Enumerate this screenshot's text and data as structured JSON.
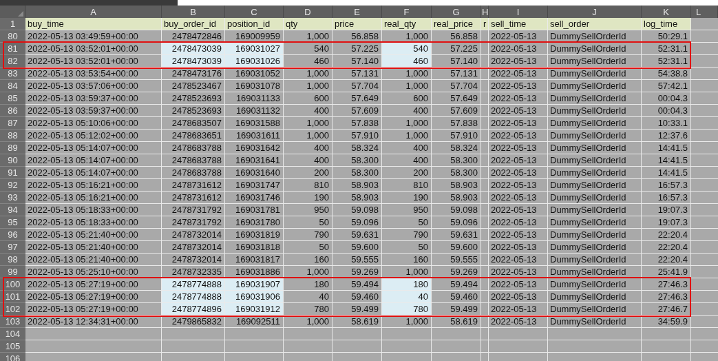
{
  "columns": [
    {
      "letter": "A",
      "header": "buy_time",
      "kind": "text",
      "highlighted": false
    },
    {
      "letter": "B",
      "header": "buy_order_id",
      "kind": "number",
      "highlighted": true
    },
    {
      "letter": "C",
      "header": "position_id",
      "kind": "number",
      "highlighted": true
    },
    {
      "letter": "D",
      "header": "qty",
      "kind": "number",
      "highlighted": false
    },
    {
      "letter": "E",
      "header": "price",
      "kind": "number",
      "highlighted": false
    },
    {
      "letter": "F",
      "header": "real_qty",
      "kind": "number",
      "highlighted": true
    },
    {
      "letter": "G",
      "header": "real_price",
      "kind": "number",
      "highlighted": false
    },
    {
      "letter": "H",
      "header": "r",
      "kind": "spacer",
      "highlighted": false
    },
    {
      "letter": "I",
      "header": "sell_time",
      "kind": "text",
      "highlighted": false
    },
    {
      "letter": "J",
      "header": "sell_order",
      "kind": "text",
      "highlighted": false
    },
    {
      "letter": "K",
      "header": "log_time",
      "kind": "number",
      "highlighted": false
    },
    {
      "letter": "L",
      "kind": "blank"
    }
  ],
  "header_row": "1",
  "rows": [
    {
      "number": "80",
      "flagged": false,
      "cells": [
        "2022-05-13 03:49:59+00:00",
        "2478472846",
        "169009959",
        "1,000",
        "56.858",
        "1,000",
        "56.858",
        "2022-05-13",
        "DummySellOrderId",
        "50:29.1"
      ]
    },
    {
      "number": "81",
      "flagged": true,
      "cells": [
        "2022-05-13 03:52:01+00:00",
        "2478473039",
        "169031027",
        "540",
        "57.225",
        "540",
        "57.225",
        "2022-05-13",
        "DummySellOrderId",
        "52:31.1"
      ]
    },
    {
      "number": "82",
      "flagged": true,
      "cells": [
        "2022-05-13 03:52:01+00:00",
        "2478473039",
        "169031026",
        "460",
        "57.140",
        "460",
        "57.140",
        "2022-05-13",
        "DummySellOrderId",
        "52:31.1"
      ]
    },
    {
      "number": "83",
      "flagged": false,
      "cells": [
        "2022-05-13 03:53:54+00:00",
        "2478473176",
        "169031052",
        "1,000",
        "57.131",
        "1,000",
        "57.131",
        "2022-05-13",
        "DummySellOrderId",
        "54:38.8"
      ]
    },
    {
      "number": "84",
      "flagged": false,
      "cells": [
        "2022-05-13 03:57:06+00:00",
        "2478523467",
        "169031078",
        "1,000",
        "57.704",
        "1,000",
        "57.704",
        "2022-05-13",
        "DummySellOrderId",
        "57:42.1"
      ]
    },
    {
      "number": "85",
      "flagged": false,
      "cells": [
        "2022-05-13 03:59:37+00:00",
        "2478523693",
        "169031133",
        "600",
        "57.649",
        "600",
        "57.649",
        "2022-05-13",
        "DummySellOrderId",
        "00:04.3"
      ]
    },
    {
      "number": "86",
      "flagged": false,
      "cells": [
        "2022-05-13 03:59:37+00:00",
        "2478523693",
        "169031132",
        "400",
        "57.609",
        "400",
        "57.609",
        "2022-05-13",
        "DummySellOrderId",
        "00:04.3"
      ]
    },
    {
      "number": "87",
      "flagged": false,
      "cells": [
        "2022-05-13 05:10:06+00:00",
        "2478683507",
        "169031588",
        "1,000",
        "57.838",
        "1,000",
        "57.838",
        "2022-05-13",
        "DummySellOrderId",
        "10:33.1"
      ]
    },
    {
      "number": "88",
      "flagged": false,
      "cells": [
        "2022-05-13 05:12:02+00:00",
        "2478683651",
        "169031611",
        "1,000",
        "57.910",
        "1,000",
        "57.910",
        "2022-05-13",
        "DummySellOrderId",
        "12:37.6"
      ]
    },
    {
      "number": "89",
      "flagged": false,
      "cells": [
        "2022-05-13 05:14:07+00:00",
        "2478683788",
        "169031642",
        "400",
        "58.324",
        "400",
        "58.324",
        "2022-05-13",
        "DummySellOrderId",
        "14:41.5"
      ]
    },
    {
      "number": "90",
      "flagged": false,
      "cells": [
        "2022-05-13 05:14:07+00:00",
        "2478683788",
        "169031641",
        "400",
        "58.300",
        "400",
        "58.300",
        "2022-05-13",
        "DummySellOrderId",
        "14:41.5"
      ]
    },
    {
      "number": "91",
      "flagged": false,
      "cells": [
        "2022-05-13 05:14:07+00:00",
        "2478683788",
        "169031640",
        "200",
        "58.300",
        "200",
        "58.300",
        "2022-05-13",
        "DummySellOrderId",
        "14:41.5"
      ]
    },
    {
      "number": "92",
      "flagged": false,
      "cells": [
        "2022-05-13 05:16:21+00:00",
        "2478731612",
        "169031747",
        "810",
        "58.903",
        "810",
        "58.903",
        "2022-05-13",
        "DummySellOrderId",
        "16:57.3"
      ]
    },
    {
      "number": "93",
      "flagged": false,
      "cells": [
        "2022-05-13 05:16:21+00:00",
        "2478731612",
        "169031746",
        "190",
        "58.903",
        "190",
        "58.903",
        "2022-05-13",
        "DummySellOrderId",
        "16:57.3"
      ]
    },
    {
      "number": "94",
      "flagged": false,
      "cells": [
        "2022-05-13 05:18:33+00:00",
        "2478731792",
        "169031781",
        "950",
        "59.098",
        "950",
        "59.098",
        "2022-05-13",
        "DummySellOrderId",
        "19:07.3"
      ]
    },
    {
      "number": "95",
      "flagged": false,
      "cells": [
        "2022-05-13 05:18:33+00:00",
        "2478731792",
        "169031780",
        "50",
        "59.096",
        "50",
        "59.096",
        "2022-05-13",
        "DummySellOrderId",
        "19:07.3"
      ]
    },
    {
      "number": "96",
      "flagged": false,
      "cells": [
        "2022-05-13 05:21:40+00:00",
        "2478732014",
        "169031819",
        "790",
        "59.631",
        "790",
        "59.631",
        "2022-05-13",
        "DummySellOrderId",
        "22:20.4"
      ]
    },
    {
      "number": "97",
      "flagged": false,
      "cells": [
        "2022-05-13 05:21:40+00:00",
        "2478732014",
        "169031818",
        "50",
        "59.600",
        "50",
        "59.600",
        "2022-05-13",
        "DummySellOrderId",
        "22:20.4"
      ]
    },
    {
      "number": "98",
      "flagged": false,
      "cells": [
        "2022-05-13 05:21:40+00:00",
        "2478732014",
        "169031817",
        "160",
        "59.555",
        "160",
        "59.555",
        "2022-05-13",
        "DummySellOrderId",
        "22:20.4"
      ]
    },
    {
      "number": "99",
      "flagged": false,
      "cells": [
        "2022-05-13 05:25:10+00:00",
        "2478732335",
        "169031886",
        "1,000",
        "59.269",
        "1,000",
        "59.269",
        "2022-05-13",
        "DummySellOrderId",
        "25:41.9"
      ]
    },
    {
      "number": "100",
      "flagged": true,
      "cells": [
        "2022-05-13 05:27:19+00:00",
        "2478774888",
        "169031907",
        "180",
        "59.494",
        "180",
        "59.494",
        "2022-05-13",
        "DummySellOrderId",
        "27:46.3"
      ]
    },
    {
      "number": "101",
      "flagged": true,
      "cells": [
        "2022-05-13 05:27:19+00:00",
        "2478774888",
        "169031906",
        "40",
        "59.460",
        "40",
        "59.460",
        "2022-05-13",
        "DummySellOrderId",
        "27:46.3"
      ]
    },
    {
      "number": "102",
      "flagged": true,
      "cells": [
        "2022-05-13 05:27:19+00:00",
        "2478774896",
        "169031912",
        "780",
        "59.499",
        "780",
        "59.499",
        "2022-05-13",
        "DummySellOrderId",
        "27:46.7"
      ]
    },
    {
      "number": "103",
      "flagged": false,
      "cells": [
        "2022-05-13 12:34:31+00:00",
        "2479865832",
        "169092511",
        "1,000",
        "58.619",
        "1,000",
        "58.619",
        "2022-05-13",
        "DummySellOrderId",
        "34:59.9"
      ]
    },
    {
      "number": "104",
      "flagged": false
    },
    {
      "number": "105",
      "flagged": false
    },
    {
      "number": "106",
      "flagged": false
    }
  ]
}
